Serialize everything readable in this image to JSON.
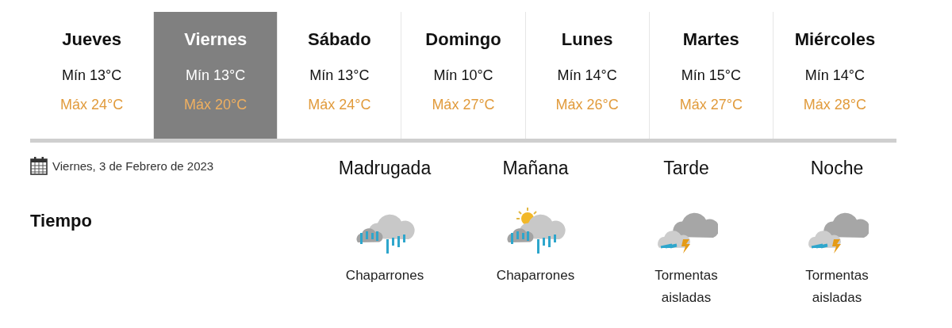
{
  "days": [
    {
      "label": "Jueves",
      "min": "Mín 13°C",
      "max": "Máx 24°C",
      "selected": false
    },
    {
      "label": "Viernes",
      "min": "Mín 13°C",
      "max": "Máx 20°C",
      "selected": true
    },
    {
      "label": "Sábado",
      "min": "Mín 13°C",
      "max": "Máx 24°C",
      "selected": false
    },
    {
      "label": "Domingo",
      "min": "Mín 10°C",
      "max": "Máx 27°C",
      "selected": false
    },
    {
      "label": "Lunes",
      "min": "Mín 14°C",
      "max": "Máx 26°C",
      "selected": false
    },
    {
      "label": "Martes",
      "min": "Mín 15°C",
      "max": "Máx 27°C",
      "selected": false
    },
    {
      "label": "Miércoles",
      "min": "Mín 14°C",
      "max": "Máx 28°C",
      "selected": false
    }
  ],
  "date": "Viernes, 3 de Febrero de 2023",
  "section_title": "Tiempo",
  "periods": [
    {
      "name": "Madrugada",
      "kind": "rain",
      "condition": "Chaparrones"
    },
    {
      "name": "Mañana",
      "kind": "rain-sun",
      "condition": "Chaparrones"
    },
    {
      "name": "Tarde",
      "kind": "storm",
      "condition": "Tormentas aisladas"
    },
    {
      "name": "Noche",
      "kind": "storm",
      "condition": "Tormentas aisladas"
    }
  ]
}
